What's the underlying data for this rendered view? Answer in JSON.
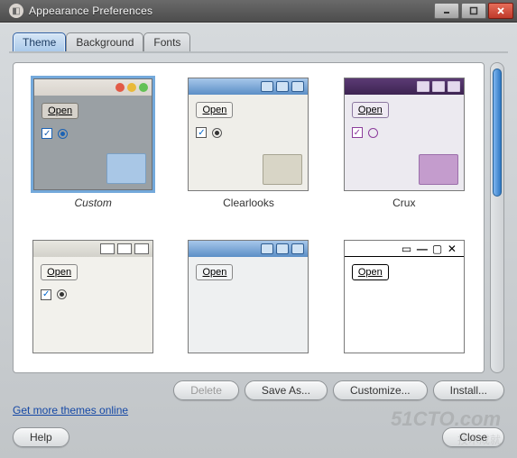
{
  "window": {
    "title": "Appearance Preferences",
    "buttons": {
      "minimize": "–",
      "maximize": "▢",
      "close": "✕"
    }
  },
  "tabs": {
    "items": [
      {
        "label": "Theme",
        "active": true
      },
      {
        "label": "Background",
        "active": false
      },
      {
        "label": "Fonts",
        "active": false
      }
    ]
  },
  "themes": [
    {
      "name": "Custom",
      "open_label": "Open",
      "selected": true,
      "style": "t-custom"
    },
    {
      "name": "Clearlooks",
      "open_label": "Open",
      "selected": false,
      "style": "t-clearlooks"
    },
    {
      "name": "Crux",
      "open_label": "Open",
      "selected": false,
      "style": "t-crux"
    },
    {
      "name": "",
      "open_label": "Open",
      "selected": false,
      "style": "t-glider"
    },
    {
      "name": "",
      "open_label": "Open",
      "selected": false,
      "style": "t-glossy"
    },
    {
      "name": "",
      "open_label": "Open",
      "selected": false,
      "style": "t-high"
    }
  ],
  "actions": {
    "delete": "Delete",
    "save_as": "Save As...",
    "customize": "Customize...",
    "install": "Install..."
  },
  "more_link": "Get more themes online",
  "footer": {
    "help": "Help",
    "close": "Close"
  },
  "watermark": {
    "big": "51CTO.com",
    "small": "技术成就"
  }
}
